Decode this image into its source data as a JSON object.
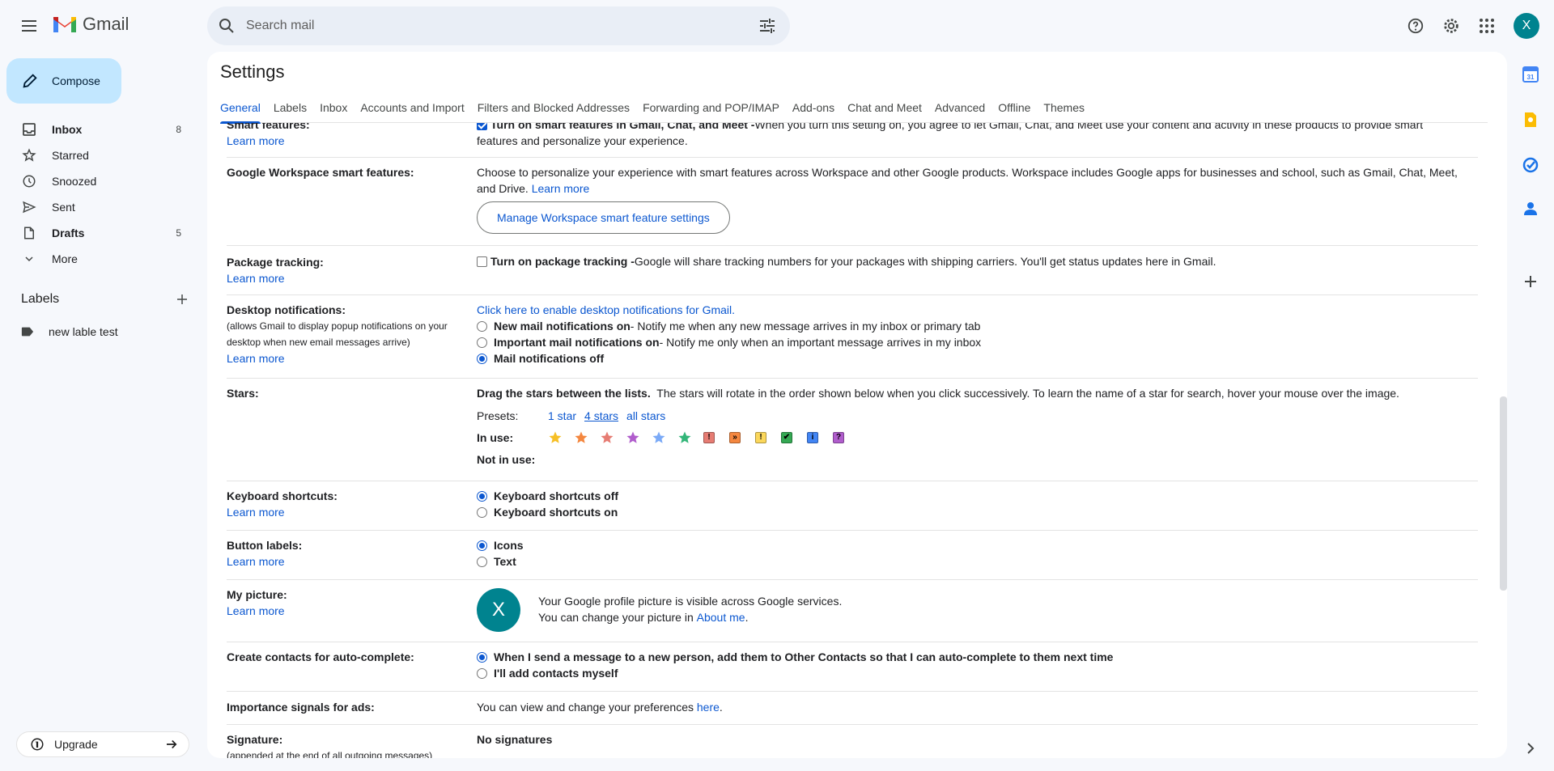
{
  "header": {
    "app_name": "Gmail",
    "search_placeholder": "Search mail",
    "avatar_letter": "X"
  },
  "compose_label": "Compose",
  "nav": [
    {
      "name": "Inbox",
      "count": "8",
      "icon": "inbox-icon",
      "bold": true
    },
    {
      "name": "Starred",
      "count": "",
      "icon": "star-outline-icon",
      "bold": false
    },
    {
      "name": "Snoozed",
      "count": "",
      "icon": "clock-icon",
      "bold": false
    },
    {
      "name": "Sent",
      "count": "",
      "icon": "send-icon",
      "bold": false
    },
    {
      "name": "Drafts",
      "count": "5",
      "icon": "draft-icon",
      "bold": true
    },
    {
      "name": "More",
      "count": "",
      "icon": "chevron-down-icon",
      "bold": false
    }
  ],
  "labels": {
    "heading": "Labels",
    "items": [
      {
        "name": "new lable test",
        "icon": "label-icon"
      }
    ]
  },
  "upgrade_label": "Upgrade",
  "settings": {
    "title": "Settings",
    "tabs": [
      "General",
      "Labels",
      "Inbox",
      "Accounts and Import",
      "Filters and Blocked Addresses",
      "Forwarding and POP/IMAP",
      "Add-ons",
      "Chat and Meet",
      "Advanced",
      "Offline",
      "Themes"
    ],
    "active_tab": "General",
    "learn_more": "Learn more",
    "smart_features": {
      "label": "Smart features:",
      "bold_text": "Turn on smart features in Gmail, Chat, and Meet -",
      "text": " When you turn this setting on, you agree to let Gmail, Chat, and Meet use your content and activity in these products to provide smart",
      "text2": "features and personalize your experience."
    },
    "workspace": {
      "label": "Google Workspace smart features:",
      "text": "Choose to personalize your experience with smart features across Workspace and other Google products. Workspace includes Google apps for businesses and school, such as Gmail, Chat, Meet,",
      "text2": "and Drive.",
      "button": "Manage Workspace smart feature settings"
    },
    "package": {
      "label": "Package tracking:",
      "bold_text": "Turn on package tracking -",
      "text": " Google will share tracking numbers for your packages with shipping carriers. You'll get status updates here in Gmail."
    },
    "desktop": {
      "label": "Desktop notifications:",
      "sub1": "(allows Gmail to display popup notifications on your",
      "sub2": "desktop when new email messages arrive)",
      "enable_link": "Click here to enable desktop notifications for Gmail.",
      "opt1_bold": "New mail notifications on",
      "opt1_text": " - Notify me when any new message arrives in my inbox or primary tab",
      "opt2_bold": "Important mail notifications on",
      "opt2_text": " - Notify me only when an important message arrives in my inbox",
      "opt3_bold": "Mail notifications off"
    },
    "stars": {
      "label": "Stars:",
      "bold_text": "Drag the stars between the lists.",
      "text": "  The stars will rotate in the order shown below when you click successively. To learn the name of a star for search, hover your mouse over the image.",
      "presets_label": "Presets:",
      "preset1": "1 star",
      "preset2": "4 stars",
      "preset3": "all stars",
      "in_use_label": "In use:",
      "not_in_use_label": "Not in use:",
      "star_colors": [
        "#f6bf26",
        "#f4873f",
        "#e67c73",
        "#b05dcc",
        "#7baaf7",
        "#33b679"
      ],
      "square_icons": [
        {
          "glyph": "!",
          "color": "#e67c73"
        },
        {
          "glyph": "»",
          "color": "#f4873f"
        },
        {
          "glyph": "!",
          "color": "#fbd75b"
        },
        {
          "glyph": "✔",
          "color": "#34a853"
        },
        {
          "glyph": "i",
          "color": "#4285f4"
        },
        {
          "glyph": "?",
          "color": "#b05dcc"
        }
      ]
    },
    "keyboard": {
      "label": "Keyboard shortcuts:",
      "opt1": "Keyboard shortcuts off",
      "opt2": "Keyboard shortcuts on"
    },
    "button_labels": {
      "label": "Button labels:",
      "opt1": "Icons",
      "opt2": "Text"
    },
    "picture": {
      "label": "My picture:",
      "avatar_letter": "X",
      "line1": "Your Google profile picture is visible across Google services.",
      "line2": "You can change your picture in ",
      "link": "About me",
      "line2_end": "."
    },
    "contacts": {
      "label": "Create contacts for auto-complete:",
      "opt1": "When I send a message to a new person, add them to Other Contacts so that I can auto-complete to them next time",
      "opt2": "I'll add contacts myself"
    },
    "ads": {
      "label": "Importance signals for ads:",
      "text": "You can view and change your preferences ",
      "link": "here",
      "end": "."
    },
    "signature": {
      "label": "Signature:",
      "sub": "(appended at the end of all outgoing messages)",
      "value": "No signatures"
    }
  }
}
